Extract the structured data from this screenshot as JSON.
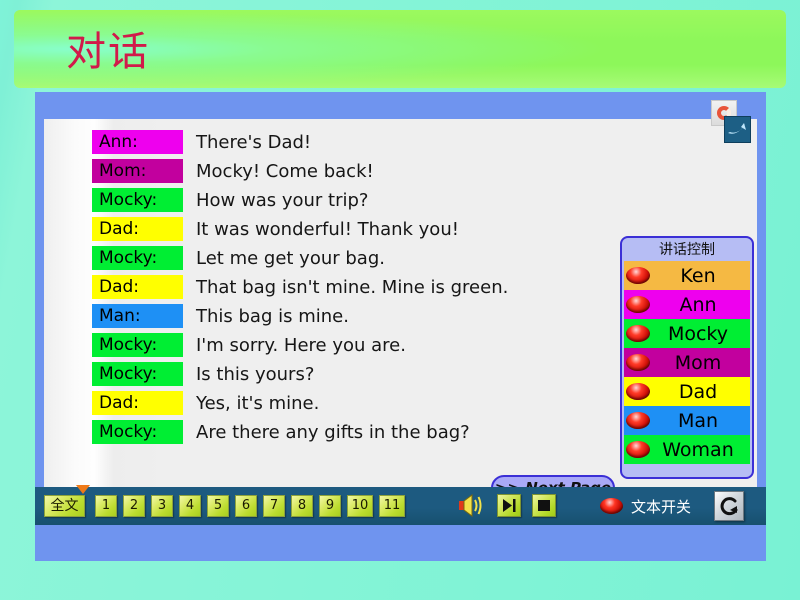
{
  "page": {
    "title": "对话",
    "title_color": "#d11a4a"
  },
  "icons": {
    "logo_circle": "logo-circle-icon",
    "logo_swoosh": "logo-swoosh-icon",
    "toolbar_marker": "triangle-marker-icon",
    "speaker": "speaker-icon",
    "play": "play-icon",
    "stop": "stop-icon",
    "return": "return-arrow-icon"
  },
  "dialogue": [
    {
      "speaker": "Ann:",
      "line": "There's Dad!",
      "bg": "#ee00ee"
    },
    {
      "speaker": "Mom:",
      "line": "Mocky! Come back!",
      "bg": "#c2009e"
    },
    {
      "speaker": "Mocky:",
      "line": "How was your trip?",
      "bg": "#00ee33"
    },
    {
      "speaker": "Dad:",
      "line": "It was wonderful! Thank you!",
      "bg": "#ffff00"
    },
    {
      "speaker": "Mocky:",
      "line": "Let me get your bag.",
      "bg": "#00ee33"
    },
    {
      "speaker": "Dad:",
      "line": "That bag isn't mine. Mine is green.",
      "bg": "#ffff00"
    },
    {
      "speaker": "Man:",
      "line": "This bag is mine.",
      "bg": "#1e90f5"
    },
    {
      "speaker": "Mocky:",
      "line": "I'm sorry. Here you are.",
      "bg": "#00ee33"
    },
    {
      "speaker": "Mocky:",
      "line": "Is this yours?",
      "bg": "#00ee33"
    },
    {
      "speaker": "Dad:",
      "line": "Yes, it's mine.",
      "bg": "#ffff00"
    },
    {
      "speaker": "Mocky:",
      "line": "Are there any gifts in the bag?",
      "bg": "#00ee33"
    }
  ],
  "next_page": {
    "label": ">> Next Page"
  },
  "speaker_panel": {
    "title": "讲话控制",
    "buttons": [
      {
        "name": "Ken",
        "bg": "#f5b943"
      },
      {
        "name": "Ann",
        "bg": "#ee00ee"
      },
      {
        "name": "Mocky",
        "bg": "#00ee33"
      },
      {
        "name": "Mom",
        "bg": "#c2009e"
      },
      {
        "name": "Dad",
        "bg": "#ffff00"
      },
      {
        "name": "Man",
        "bg": "#1e90f5"
      },
      {
        "name": "Woman",
        "bg": "#00ee33"
      }
    ]
  },
  "toolbar": {
    "all_label": "全文",
    "numbers": [
      "1",
      "2",
      "3",
      "4",
      "5",
      "6",
      "7",
      "8",
      "9",
      "10",
      "11"
    ],
    "text_toggle_label": "文本开关"
  }
}
